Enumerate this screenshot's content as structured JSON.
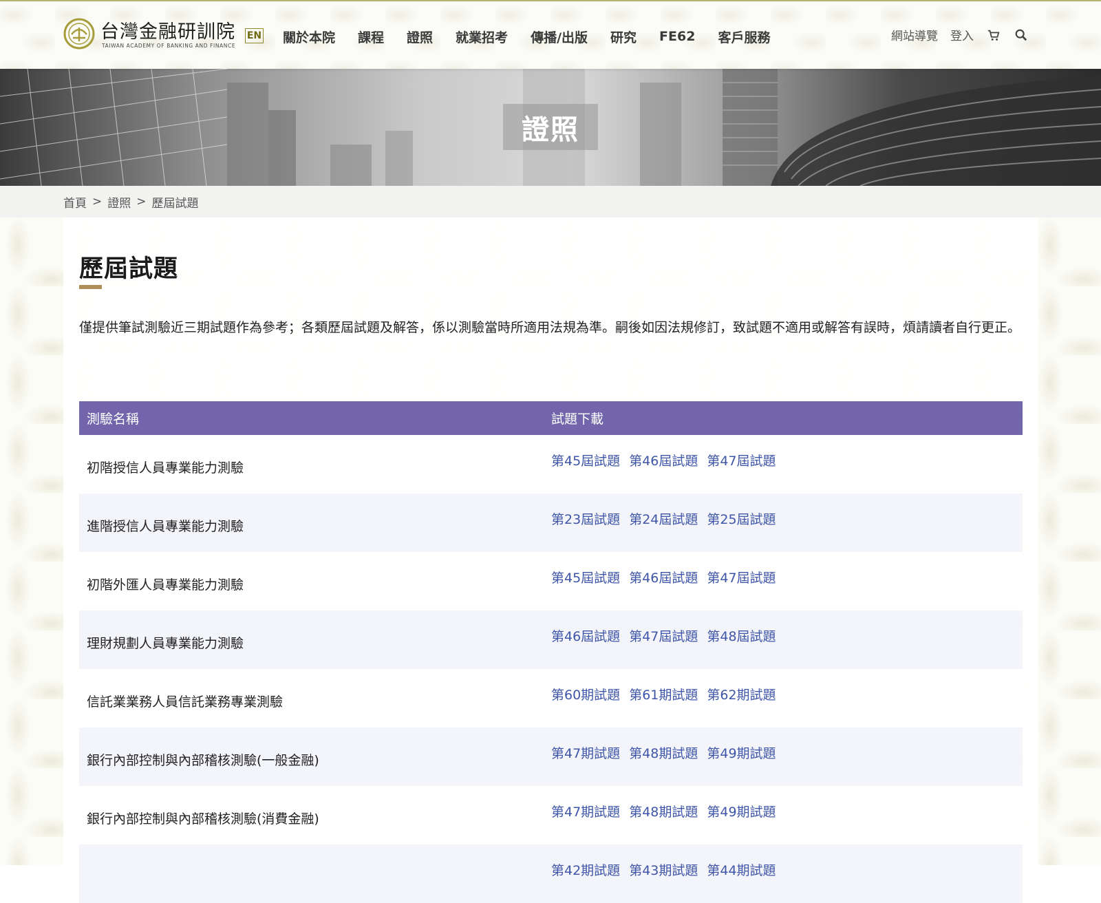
{
  "header": {
    "logo_cn": "台灣金融研訓院",
    "logo_en": "TAIWAN ACADEMY OF BANKING AND FINANCE",
    "en_label": "EN",
    "nav": [
      "關於本院",
      "課程",
      "證照",
      "就業招考",
      "傳播/出版",
      "研究",
      "FE62",
      "客戶服務"
    ],
    "sitemap_label": "網站導覽",
    "login_label": "登入",
    "icons": [
      "cart-icon",
      "search-icon"
    ]
  },
  "banner": {
    "title": "證照"
  },
  "breadcrumb": {
    "items": [
      "首頁",
      "證照",
      "歷屆試題"
    ],
    "separator": ">"
  },
  "main": {
    "title": "歷屆試題",
    "intro": "僅提供筆試測驗近三期試題作為參考；各類歷屆試題及解答，係以測驗當時所適用法規為準。嗣後如因法規修訂，致試題不適用或解答有誤時，煩請讀者自行更正。",
    "table": {
      "headers": [
        "測驗名稱",
        "試題下載"
      ],
      "rows": [
        {
          "name": "初階授信人員專業能力測驗",
          "links": [
            "第45屆試題",
            "第46屆試題",
            "第47屆試題"
          ]
        },
        {
          "name": "進階授信人員專業能力測驗",
          "links": [
            "第23屆試題",
            "第24屆試題",
            "第25屆試題"
          ]
        },
        {
          "name": "初階外匯人員專業能力測驗",
          "links": [
            "第45屆試題",
            "第46屆試題",
            "第47屆試題"
          ]
        },
        {
          "name": "理財規劃人員專業能力測驗",
          "links": [
            "第46屆試題",
            "第47屆試題",
            "第48屆試題"
          ]
        },
        {
          "name": "信託業業務人員信託業務專業測驗",
          "links": [
            "第60期試題",
            "第61期試題",
            "第62期試題"
          ]
        },
        {
          "name": "銀行內部控制與內部稽核測驗(一般金融)",
          "links": [
            "第47期試題",
            "第48期試題",
            "第49期試題"
          ]
        },
        {
          "name": "銀行內部控制與內部稽核測驗(消費金融)",
          "links": [
            "第47期試題",
            "第48期試題",
            "第49期試題"
          ]
        },
        {
          "name": "",
          "links": [
            "第42期試題",
            "第43期試題",
            "第44期試題"
          ]
        }
      ]
    }
  },
  "colors": {
    "accent": "#7265ab",
    "link": "#3f56a8",
    "title_bar": "#b08e5a",
    "logo_gold": "#a69d3a"
  }
}
